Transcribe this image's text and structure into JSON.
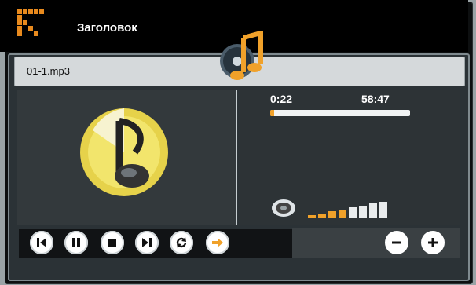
{
  "header": {
    "title": "Заголовок"
  },
  "file": {
    "name": "01-1.mp3"
  },
  "playback": {
    "current_time": "0:22",
    "total_time": "58:47",
    "progress_fraction": 0.03
  },
  "volume": {
    "level_fraction": 0.55
  },
  "controls": {
    "icons": [
      "previous-icon",
      "pause-icon",
      "stop-icon",
      "next-icon",
      "repeat-icon",
      "forward-arrow-icon"
    ]
  },
  "colors": {
    "accent": "#f0a12a",
    "header_bg": "#000000",
    "panel_bg": "#2b3236"
  }
}
